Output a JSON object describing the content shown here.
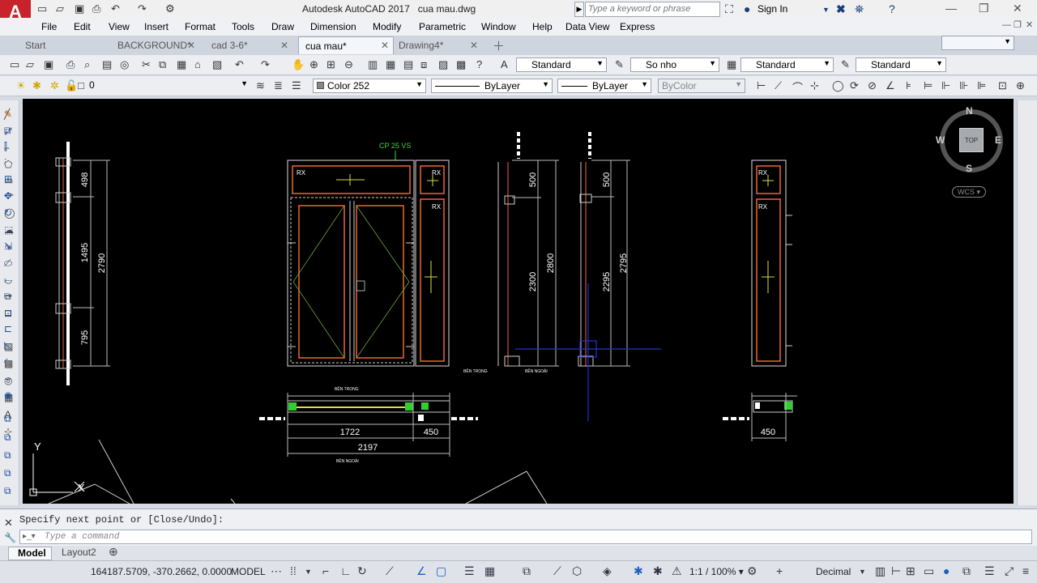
{
  "app": {
    "title": "Autodesk AutoCAD 2017",
    "file": "cua mau.dwg",
    "logo_letter": "A",
    "search_placeholder": "Type a keyword or phrase",
    "signin": "Sign In"
  },
  "menu": [
    "File",
    "Edit",
    "View",
    "Insert",
    "Format",
    "Tools",
    "Draw",
    "Dimension",
    "Modify",
    "Parametric",
    "Window",
    "Help",
    "Data View",
    "Express"
  ],
  "tabs": [
    {
      "label": "Start",
      "closable": false,
      "active": false
    },
    {
      "label": "BACKGROUND*",
      "closable": true,
      "active": false
    },
    {
      "label": "cad 3-6*",
      "closable": true,
      "active": false
    },
    {
      "label": "cua mau*",
      "closable": true,
      "active": true
    },
    {
      "label": "Drawing4*",
      "closable": true,
      "active": false
    }
  ],
  "toolbar1": {
    "text_style": "Standard",
    "dim_style": "So nho",
    "table_style": "Standard",
    "mleader_style": "Standard"
  },
  "toolbar2": {
    "layer": "0",
    "color": "Color 252",
    "linetype": "ByLayer",
    "lineweight": "ByLayer",
    "plotstyle": "ByColor"
  },
  "viewcube": {
    "n": "N",
    "s": "S",
    "e": "E",
    "w": "W",
    "top": "TOP",
    "wcs": "WCS"
  },
  "drawing": {
    "label_cp": "CP 25 VS",
    "rx": "RX",
    "dims_left": [
      "498",
      "1495",
      "795",
      "2790"
    ],
    "dims_sec1": [
      "500",
      "2300",
      "2800"
    ],
    "dims_sec2": [
      "500",
      "2295",
      "2795"
    ],
    "dims_plan": [
      "1722",
      "450",
      "2197"
    ],
    "dims_plan2": [
      "450"
    ],
    "ben_trong": "BÊN TRONG",
    "ben_ngoai": "BÊN NGOÀI",
    "ucs_y": "Y",
    "ucs_x": "X"
  },
  "command": {
    "history": "Specify next point or [Close/Undo]:",
    "prompt": "Type a command"
  },
  "layouts": [
    "Model",
    "Layout2"
  ],
  "status": {
    "coords": "164187.5709, -370.2662, 0.0000",
    "space": "MODEL",
    "scale": "1:1 / 100%",
    "units": "Decimal"
  }
}
